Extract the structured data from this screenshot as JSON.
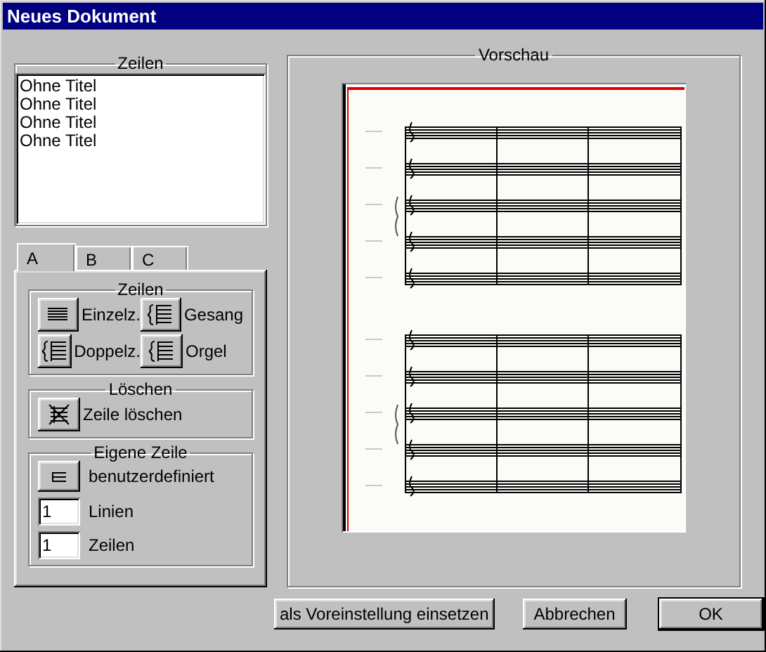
{
  "window": {
    "title": "Neues Dokument"
  },
  "lines_group": {
    "title": "Zeilen",
    "items": [
      "Ohne Titel",
      "Ohne Titel",
      "Ohne Titel",
      "Ohne Titel"
    ]
  },
  "tabs": [
    {
      "label": "A",
      "selected": true
    },
    {
      "label": "B",
      "selected": false
    },
    {
      "label": "C",
      "selected": false
    }
  ],
  "staff_group": {
    "title": "Zeilen",
    "buttons": [
      {
        "label": "Einzelz.",
        "kind": "single"
      },
      {
        "label": "Gesang",
        "kind": "brace"
      },
      {
        "label": "Doppelz.",
        "kind": "brace"
      },
      {
        "label": "Orgel",
        "kind": "brace"
      }
    ]
  },
  "delete_group": {
    "title": "Löschen",
    "button": "Zeile löschen"
  },
  "custom_group": {
    "title": "Eigene Zeile",
    "button": "benutzerdefiniert",
    "fields": [
      {
        "value": "1",
        "label": "Linien"
      },
      {
        "value": "1",
        "label": "Zeilen"
      }
    ]
  },
  "preview": {
    "title": "Vorschau"
  },
  "buttons": [
    {
      "label": "als Voreinstellung einsetzen",
      "default": false
    },
    {
      "label": "Abbrechen",
      "default": false
    },
    {
      "label": "OK",
      "default": true
    }
  ]
}
